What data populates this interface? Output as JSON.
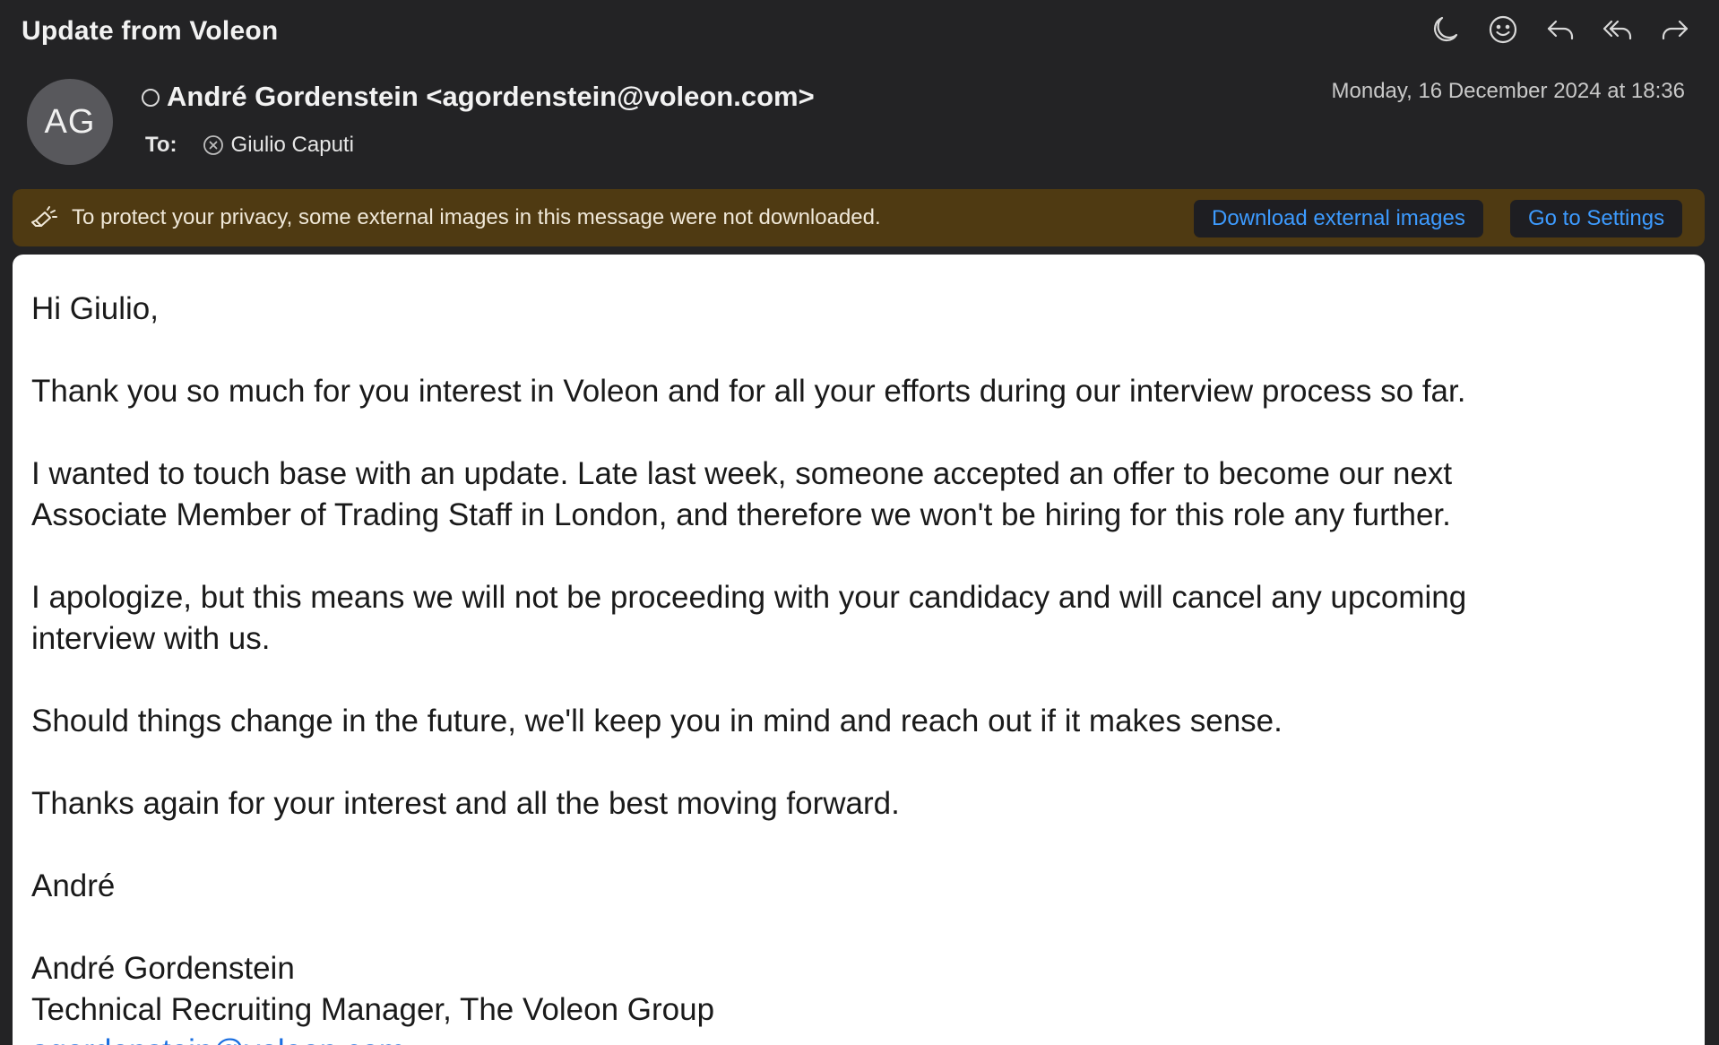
{
  "subject": "Update from Voleon",
  "toolbar": [
    {
      "name": "dark-mode-icon"
    },
    {
      "name": "emoji-icon"
    },
    {
      "name": "reply-icon"
    },
    {
      "name": "reply-all-icon"
    },
    {
      "name": "forward-icon"
    }
  ],
  "sender": {
    "initials": "AG",
    "display": "André Gordenstein <agordenstein@voleon.com>"
  },
  "to": {
    "label": "To:",
    "recipient": "Giulio Caputi"
  },
  "date": "Monday, 16 December 2024 at 18:36",
  "privacy_banner": {
    "text": "To protect your privacy, some external images in this message were not downloaded.",
    "download_label": "Download external images",
    "settings_label": "Go to Settings",
    "color": "#4f3a12"
  },
  "body": {
    "greeting": "Hi Giulio,",
    "p1": "Thank you so much for you interest in Voleon and for all your efforts during our interview process so far.",
    "p2_line1": "I wanted to touch base with an update. Late last week, someone accepted an offer to become our next",
    "p2_line2": "Associate Member of Trading Staff in London, and therefore we won't be hiring for this role any further.",
    "p3_line1": "I apologize, but this means we will not be proceeding with your candidacy and will cancel any upcoming",
    "p3_line2": "interview with us.",
    "p4": "Should things change in the future, we'll keep you in mind and reach out if it makes sense.",
    "p5": "Thanks again for your interest and all the best moving forward.",
    "signoff": "André",
    "sig_name": "André Gordenstein",
    "sig_title": "Technical Recruiting Manager, The Voleon Group",
    "sig_link": "agordenstein@voleon.com"
  },
  "colors": {
    "window_bg": "#232325",
    "link": "#3d9bff"
  }
}
